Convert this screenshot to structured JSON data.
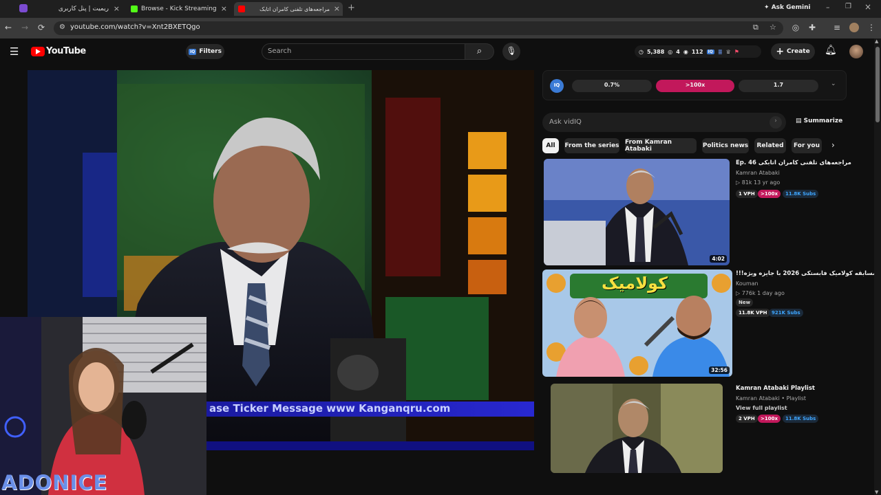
{
  "browser": {
    "tabs": [
      {
        "label": "ریمیت | پنل کاربری",
        "favicon_color": "#7b4bd1"
      },
      {
        "label": "Browse - Kick Streaming",
        "favicon_color": "#53fc18"
      },
      {
        "label": "مراجعه‌های تلفنی کامران اتابک",
        "favicon_color": "#ff0000"
      }
    ],
    "new_tab": "+",
    "ask_gemini": "Ask Gemini",
    "url": "youtube.com/watch?v=Xnt2BXETQgo"
  },
  "youtube": {
    "logo": "YouTube",
    "filters": "Filters",
    "search_placeholder": "Search",
    "stats": {
      "views": "5,388",
      "likes": "4",
      "watching": "112"
    },
    "create": "Create"
  },
  "video": {
    "ticker": "ase Ticker Message www Kanganqru.com",
    "watermark": "ADONICE"
  },
  "vidiq": {
    "logo": "IQ",
    "metrics": [
      "0.7%",
      ">100x",
      "1.7"
    ],
    "ask_placeholder": "Ask vidIQ",
    "summarize": "Summarize"
  },
  "chips": [
    "All",
    "From the series",
    "From Kamran Atabaki",
    "Politics news",
    "Related",
    "For you"
  ],
  "recommendations": [
    {
      "title": "Ep. 46 مراجعه‌های تلفنی کامران اتابکی",
      "channel": "Kamran Atabaki",
      "meta": "▷ 81k  13 yr ago",
      "badge1": "1 VPH",
      "badge2": ">100x",
      "badge3": "11.8K Subs",
      "duration": "4:02"
    },
    {
      "title": "مسابقه کولامیک فابستکی 2026 با جایزه ویژه!!!",
      "channel": "Kouman",
      "meta": "▷ 776k  1 day ago",
      "tag": "New",
      "badge1": "11.8K VPH",
      "badge3": "921K Subs",
      "duration": "32:56",
      "thumb_text": "کولامیک"
    },
    {
      "title": "Kamran Atabaki Playlist",
      "channel": "Kamran Atabaki • Playlist",
      "meta": "View full playlist",
      "badge1": "2 VPH",
      "badge2": ">100x",
      "badge3": "11.8K Subs"
    }
  ],
  "colors": {
    "accent_red": "#ff0000",
    "vidiq_pink": "#c2185b",
    "subs_blue": "#3ea6ff"
  }
}
